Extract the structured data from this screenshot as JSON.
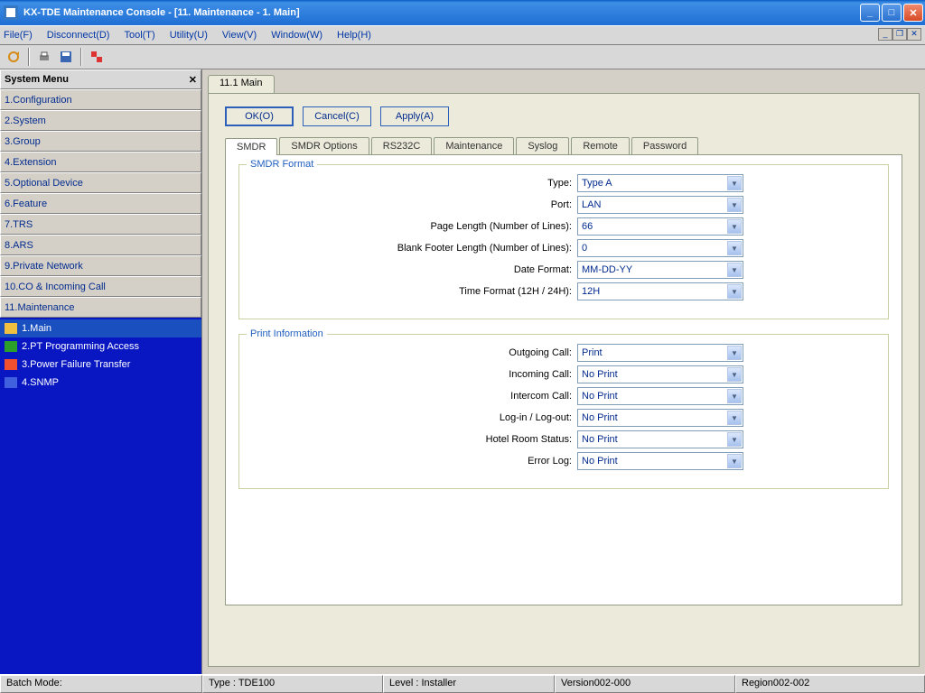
{
  "title": "KX-TDE Maintenance Console - [11. Maintenance - 1. Main]",
  "menubar": {
    "file": "File(F)",
    "disconnect": "Disconnect(D)",
    "tool": "Tool(T)",
    "utility": "Utility(U)",
    "view": "View(V)",
    "window": "Window(W)",
    "help": "Help(H)"
  },
  "sidebar": {
    "title": "System Menu",
    "items": [
      "1.Configuration",
      "2.System",
      "3.Group",
      "4.Extension",
      "5.Optional Device",
      "6.Feature",
      "7.TRS",
      "8.ARS",
      "9.Private Network",
      "10.CO & Incoming Call",
      "11.Maintenance"
    ],
    "subtree": [
      "1.Main",
      "2.PT Programming Access",
      "3.Power Failure Transfer",
      "4.SNMP"
    ]
  },
  "content": {
    "filetab": "11.1 Main",
    "buttons": {
      "ok": "OK(O)",
      "cancel": "Cancel(C)",
      "apply": "Apply(A)"
    },
    "tabs": [
      "SMDR",
      "SMDR Options",
      "RS232C",
      "Maintenance",
      "Syslog",
      "Remote",
      "Password"
    ],
    "smdr_format": {
      "legend": "SMDR Format",
      "rows": [
        {
          "label": "Type:",
          "value": "Type A"
        },
        {
          "label": "Port:",
          "value": "LAN"
        },
        {
          "label": "Page Length (Number of Lines):",
          "value": "66"
        },
        {
          "label": "Blank Footer Length (Number of Lines):",
          "value": "0"
        },
        {
          "label": "Date Format:",
          "value": "MM-DD-YY"
        },
        {
          "label": "Time Format (12H / 24H):",
          "value": "12H"
        }
      ]
    },
    "print_info": {
      "legend": "Print Information",
      "rows": [
        {
          "label": "Outgoing Call:",
          "value": "Print"
        },
        {
          "label": "Incoming Call:",
          "value": "No Print"
        },
        {
          "label": "Intercom Call:",
          "value": "No Print"
        },
        {
          "label": "Log-in / Log-out:",
          "value": "No Print"
        },
        {
          "label": "Hotel Room Status:",
          "value": "No Print"
        },
        {
          "label": "Error Log:",
          "value": "No Print"
        }
      ]
    }
  },
  "status": {
    "batch": "Batch Mode:",
    "type": "Type : TDE100",
    "level": "Level : Installer",
    "version": "Version002-000",
    "region": "Region002-002"
  }
}
